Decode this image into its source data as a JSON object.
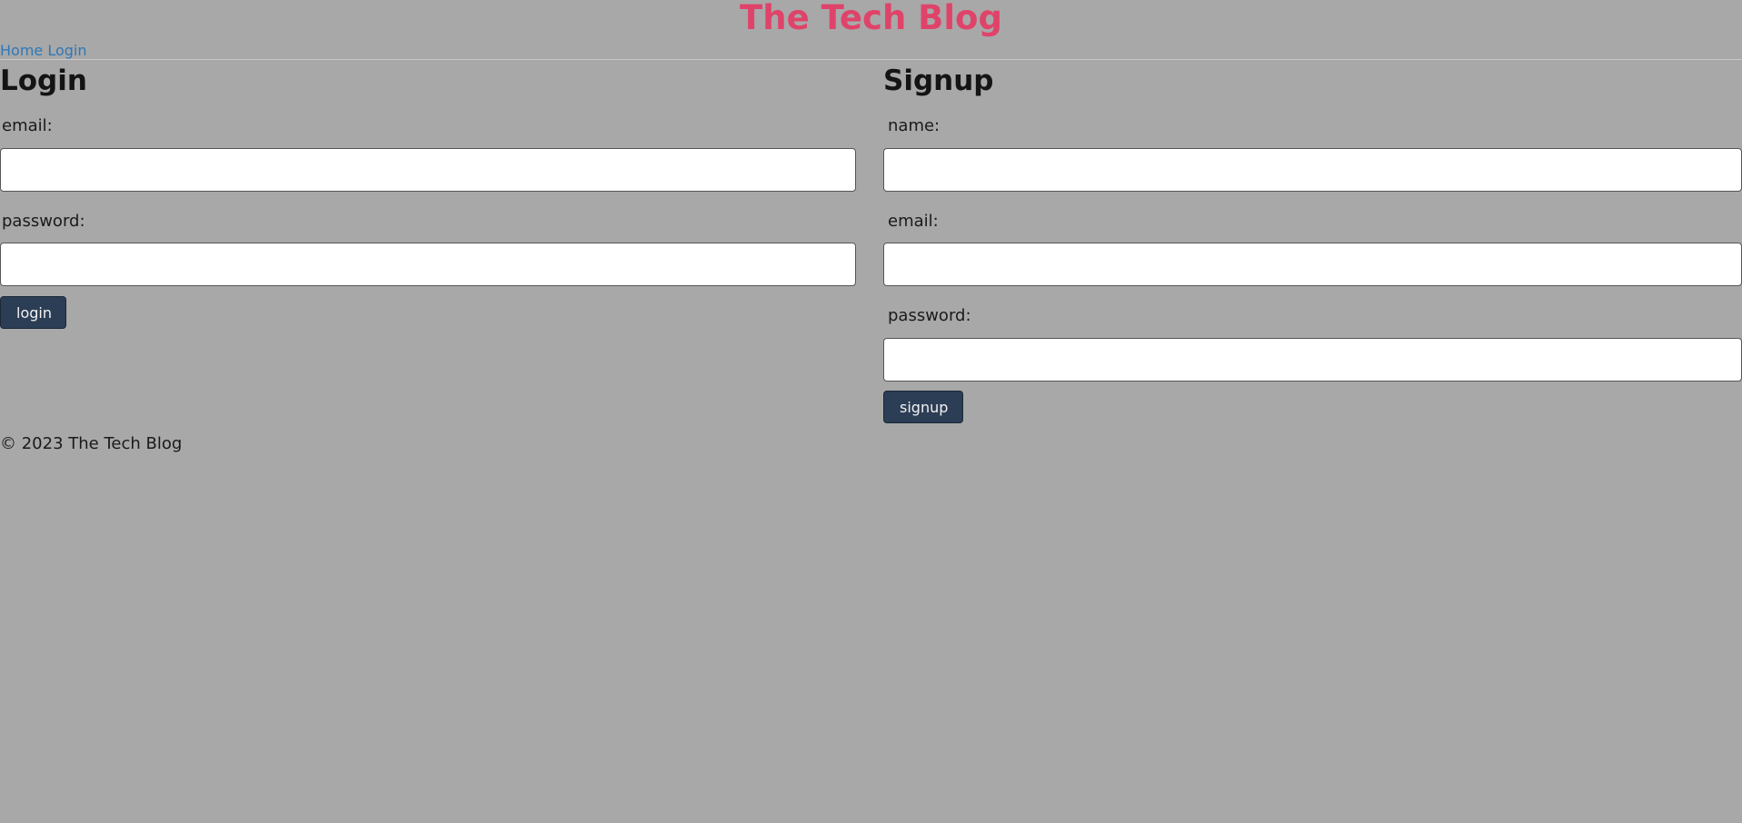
{
  "header": {
    "title": "The Tech Blog",
    "nav": [
      {
        "label": "Home"
      },
      {
        "label": "Login"
      }
    ],
    "title_color": "#e0436a",
    "link_color": "#2f78b8"
  },
  "login": {
    "heading": "Login",
    "email_label": "email:",
    "email_value": "",
    "password_label": "password:",
    "password_value": "",
    "button_label": "login"
  },
  "signup": {
    "heading": "Signup",
    "name_label": "name:",
    "name_value": "",
    "email_label": "email:",
    "email_value": "",
    "password_label": "password:",
    "password_value": "",
    "button_label": "signup"
  },
  "footer": {
    "text": "© 2023 The Tech Blog"
  },
  "colors": {
    "background": "#a8a8a8",
    "button": "#2c3e55"
  }
}
